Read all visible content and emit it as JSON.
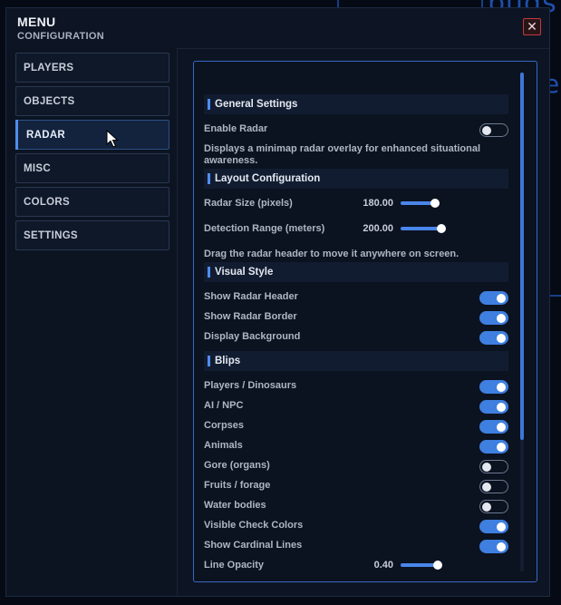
{
  "background": {
    "text_top": "buds",
    "text_side": "e"
  },
  "window": {
    "title": "MENU",
    "subtitle": "CONFIGURATION",
    "close_symbol": "✕"
  },
  "sidebar": {
    "items": [
      {
        "label": "PLAYERS",
        "active": false
      },
      {
        "label": "OBJECTS",
        "active": false
      },
      {
        "label": "RADAR",
        "active": true
      },
      {
        "label": "MISC",
        "active": false
      },
      {
        "label": "COLORS",
        "active": false
      },
      {
        "label": "SETTINGS",
        "active": false
      }
    ]
  },
  "panel": {
    "sections": {
      "general": "General Settings",
      "layout": "Layout Configuration",
      "visual": "Visual Style",
      "blips": "Blips"
    },
    "enable_radar": {
      "label": "Enable Radar",
      "on": false
    },
    "enable_radar_desc": "Displays a minimap radar overlay for enhanced situational awareness.",
    "radar_size": {
      "label": "Radar Size (pixels)",
      "value": "180.00",
      "fraction": 0.9
    },
    "detection_range": {
      "label": "Detection Range (meters)",
      "value": "200.00",
      "fraction": 1.0
    },
    "layout_hint": "Drag the radar header to move it anywhere on screen.",
    "visual": [
      {
        "label": "Show Radar Header",
        "on": true
      },
      {
        "label": "Show Radar Border",
        "on": true
      },
      {
        "label": "Display Background",
        "on": true
      }
    ],
    "blips": [
      {
        "label": "Players / Dinosaurs",
        "on": true
      },
      {
        "label": "AI / NPC",
        "on": true
      },
      {
        "label": "Corpses",
        "on": true
      },
      {
        "label": "Animals",
        "on": true
      },
      {
        "label": "Gore (organs)",
        "on": false
      },
      {
        "label": "Fruits / forage",
        "on": false
      },
      {
        "label": "Water bodies",
        "on": false
      },
      {
        "label": "Visible Check Colors",
        "on": true
      },
      {
        "label": "Show Cardinal Lines",
        "on": true
      }
    ],
    "line_opacity": {
      "label": "Line Opacity",
      "value": "0.40",
      "fraction": 0.9
    }
  },
  "colors": {
    "accent": "#3f7fe0",
    "close_border": "#c13a3a",
    "panel_border": "#3a67c4"
  }
}
